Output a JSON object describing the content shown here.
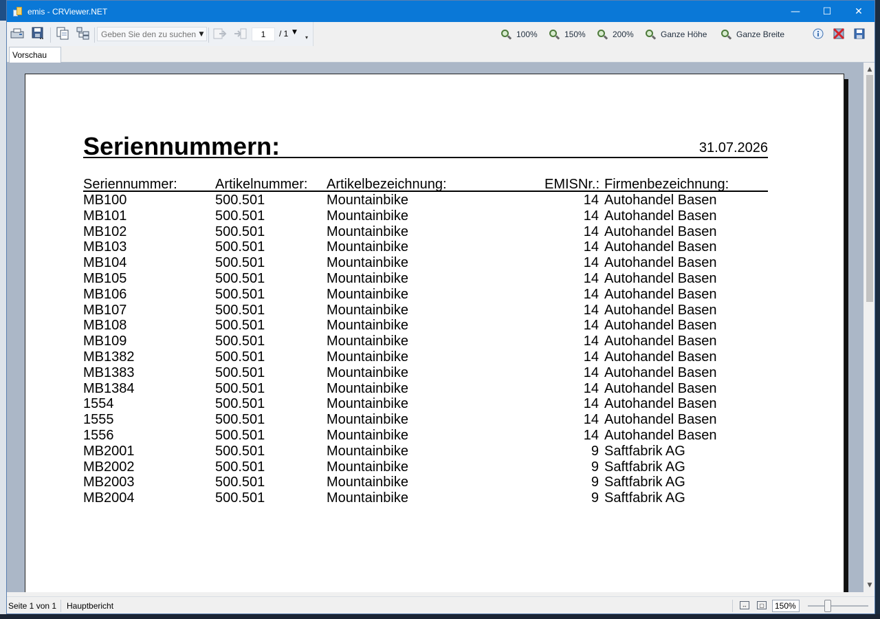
{
  "window": {
    "title": "emis - CRViewer.NET",
    "minimize": "—",
    "maximize": "☐",
    "close": "✕"
  },
  "toolbar": {
    "search_placeholder": "Geben Sie den zu suchen",
    "page_current": "1",
    "page_total": "/ 1",
    "zoom_100": "100%",
    "zoom_150": "150%",
    "zoom_200": "200%",
    "whole_height": "Ganze Höhe",
    "whole_width": "Ganze Breite"
  },
  "tabs": [
    {
      "label": "Vorschau"
    }
  ],
  "report": {
    "title": "Seriennummern:",
    "date": "31.07.2026",
    "columns": {
      "seriennummer": "Seriennummer:",
      "artikelnummer": "Artikelnummer:",
      "artikelbezeichnung": "Artikelbezeichnung:",
      "emisnr": "EMISNr.:",
      "firmenbezeichnung": "Firmenbezeichnung:"
    },
    "rows": [
      {
        "sn": "MB100",
        "an": "500.501",
        "ab": "Mountainbike",
        "em": "14",
        "fb": "Autohandel Basen"
      },
      {
        "sn": "MB101",
        "an": "500.501",
        "ab": "Mountainbike",
        "em": "14",
        "fb": "Autohandel Basen"
      },
      {
        "sn": "MB102",
        "an": "500.501",
        "ab": "Mountainbike",
        "em": "14",
        "fb": "Autohandel Basen"
      },
      {
        "sn": "MB103",
        "an": "500.501",
        "ab": "Mountainbike",
        "em": "14",
        "fb": "Autohandel Basen"
      },
      {
        "sn": "MB104",
        "an": "500.501",
        "ab": "Mountainbike",
        "em": "14",
        "fb": "Autohandel Basen"
      },
      {
        "sn": "MB105",
        "an": "500.501",
        "ab": "Mountainbike",
        "em": "14",
        "fb": "Autohandel Basen"
      },
      {
        "sn": "MB106",
        "an": "500.501",
        "ab": "Mountainbike",
        "em": "14",
        "fb": "Autohandel Basen"
      },
      {
        "sn": "MB107",
        "an": "500.501",
        "ab": "Mountainbike",
        "em": "14",
        "fb": "Autohandel Basen"
      },
      {
        "sn": "MB108",
        "an": "500.501",
        "ab": "Mountainbike",
        "em": "14",
        "fb": "Autohandel Basen"
      },
      {
        "sn": "MB109",
        "an": "500.501",
        "ab": "Mountainbike",
        "em": "14",
        "fb": "Autohandel Basen"
      },
      {
        "sn": "MB1382",
        "an": "500.501",
        "ab": "Mountainbike",
        "em": "14",
        "fb": "Autohandel Basen"
      },
      {
        "sn": "MB1383",
        "an": "500.501",
        "ab": "Mountainbike",
        "em": "14",
        "fb": "Autohandel Basen"
      },
      {
        "sn": "MB1384",
        "an": "500.501",
        "ab": "Mountainbike",
        "em": "14",
        "fb": "Autohandel Basen"
      },
      {
        "sn": "1554",
        "an": "500.501",
        "ab": "Mountainbike",
        "em": "14",
        "fb": "Autohandel Basen"
      },
      {
        "sn": "1555",
        "an": "500.501",
        "ab": "Mountainbike",
        "em": "14",
        "fb": "Autohandel Basen"
      },
      {
        "sn": "1556",
        "an": "500.501",
        "ab": "Mountainbike",
        "em": "14",
        "fb": "Autohandel Basen"
      },
      {
        "sn": "MB2001",
        "an": "500.501",
        "ab": "Mountainbike",
        "em": "9",
        "fb": "Saftfabrik AG"
      },
      {
        "sn": "MB2002",
        "an": "500.501",
        "ab": "Mountainbike",
        "em": "9",
        "fb": "Saftfabrik AG"
      },
      {
        "sn": "MB2003",
        "an": "500.501",
        "ab": "Mountainbike",
        "em": "9",
        "fb": "Saftfabrik AG"
      },
      {
        "sn": "MB2004",
        "an": "500.501",
        "ab": "Mountainbike",
        "em": "9",
        "fb": "Saftfabrik AG"
      }
    ]
  },
  "status": {
    "page_info": "Seite 1 von 1",
    "report_name": "Hauptbericht",
    "zoom": "150%"
  }
}
